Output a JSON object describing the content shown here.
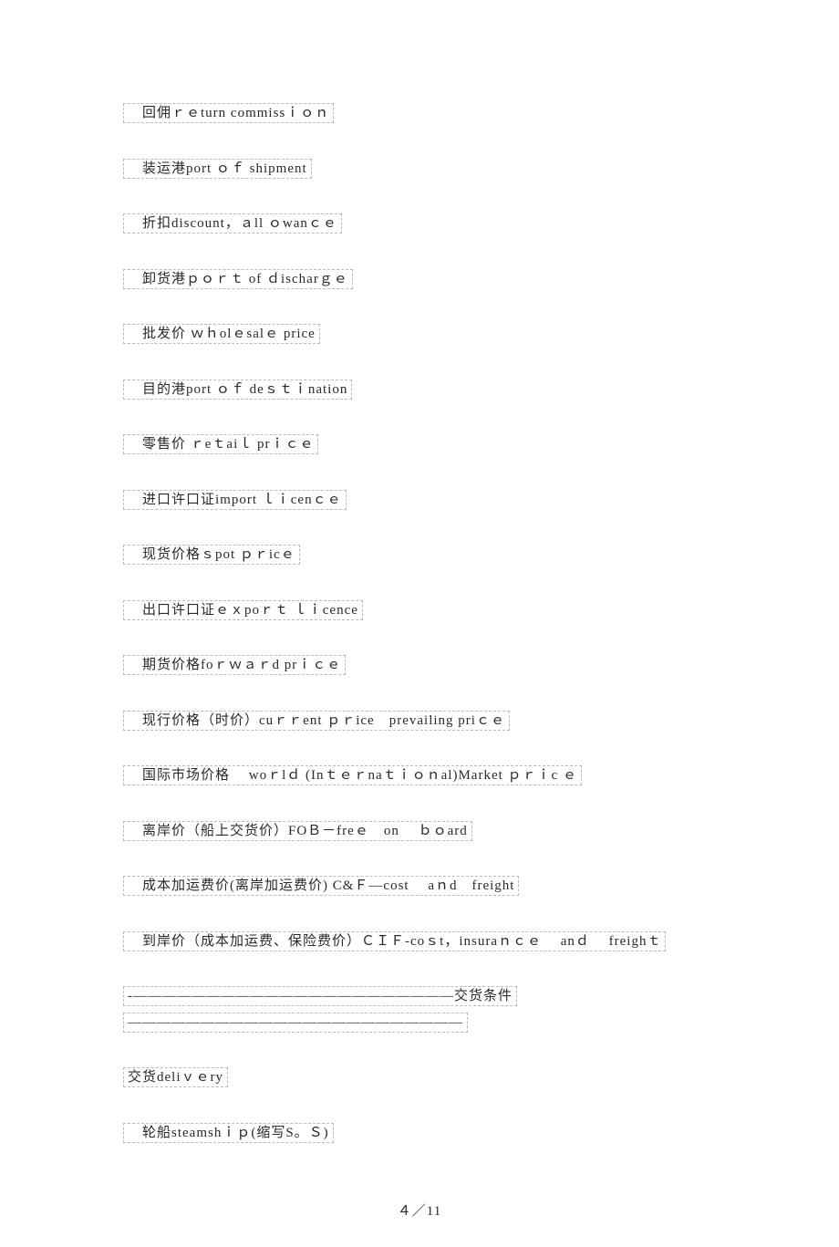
{
  "lines": [
    "　回佣ｒｅturn commissｉｏｎ",
    "　装运港port ｏｆ shipment",
    "　折扣discount，ａll ｏwanｃｅ",
    "　卸货港ｐｏｒｔ of ｄischarｇｅ",
    "　批发价 ｗｈοlｅsalｅ price",
    "　目的港port ｏｆ deｓｔｉnation",
    "　零售价 ｒeｔaiｌ prｉｃｅ",
    "　进口许口证import ｌｉcenｃｅ",
    "　现货价格ｓpot ｐｒicｅ",
    "　出口许口证ｅｘpoｒｔ ｌｉcence",
    "　期货价格foｒｗａｒd prｉｃｅ",
    "　现行价格（时价）cuｒｒent ｐｒice　prevailing priｃｅ",
    "　国际市场价格　 woｒlｄ (Inｔｅｒnaｔｉｏｎal)Market ｐｒｉc ｅ",
    "　离岸价（船上交货价）FOＢ－freｅ　on 　ｂｏard",
    "　成本加运费价(离岸加运费价) C&Ｆ―cost 　aｎd　freight",
    "　到岸价（成本加运费、保险费价）ＣＩＦ-coｓt，insuraｎｃｅ 　anｄ　 freighｔ",
    "-――――――――――――――――――――――交货条件―――――――――――――――――――――――",
    "交货deliｖｅry",
    "　轮船steamshｉｐ(缩写S。Ｓ)"
  ],
  "page_number": "４／11"
}
